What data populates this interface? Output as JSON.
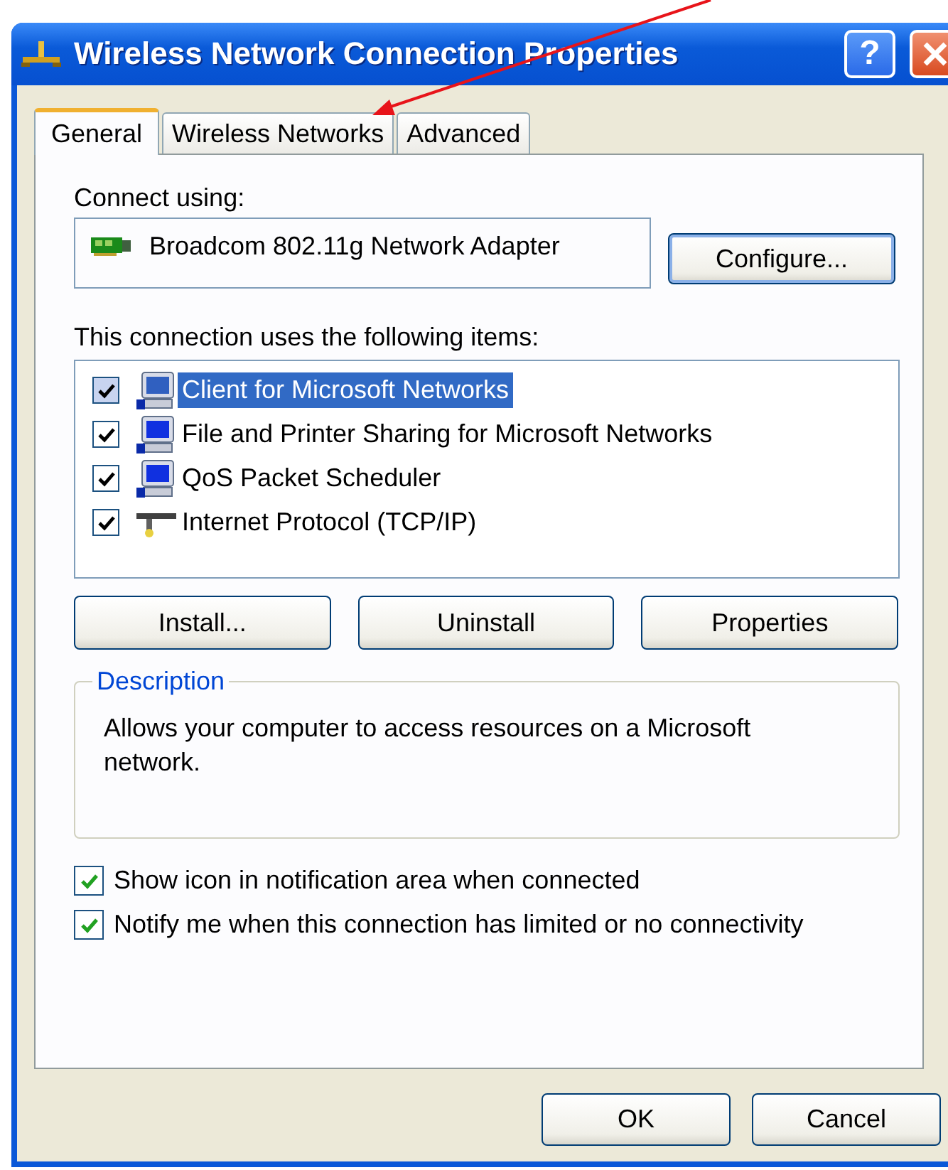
{
  "window": {
    "title": "Wireless Network Connection Properties",
    "help_label": "?"
  },
  "tabs": [
    {
      "label": "General",
      "selected": true
    },
    {
      "label": "Wireless Networks",
      "selected": false
    },
    {
      "label": "Advanced",
      "selected": false
    }
  ],
  "connect_using": {
    "label": "Connect using:",
    "adapter": "Broadcom 802.11g Network Adapter",
    "button": "Configure..."
  },
  "items_label": "This connection uses the following items:",
  "items": [
    {
      "label": "Client for Microsoft Networks",
      "checked": true,
      "selected": true,
      "kind": "computer"
    },
    {
      "label": "File and Printer Sharing for Microsoft Networks",
      "checked": true,
      "selected": false,
      "kind": "computer"
    },
    {
      "label": "QoS Packet Scheduler",
      "checked": true,
      "selected": false,
      "kind": "computer"
    },
    {
      "label": "Internet Protocol (TCP/IP)",
      "checked": true,
      "selected": false,
      "kind": "protocol"
    }
  ],
  "item_buttons": [
    "Install...",
    "Uninstall",
    "Properties"
  ],
  "description": {
    "title": "Description",
    "text": "Allows your computer to access resources on a Microsoft network."
  },
  "options": [
    {
      "label": "Show icon in notification area when connected",
      "checked": true
    },
    {
      "label": "Notify me when this connection has limited or no connectivity",
      "checked": true
    }
  ],
  "buttons": [
    "OK",
    "Cancel"
  ]
}
